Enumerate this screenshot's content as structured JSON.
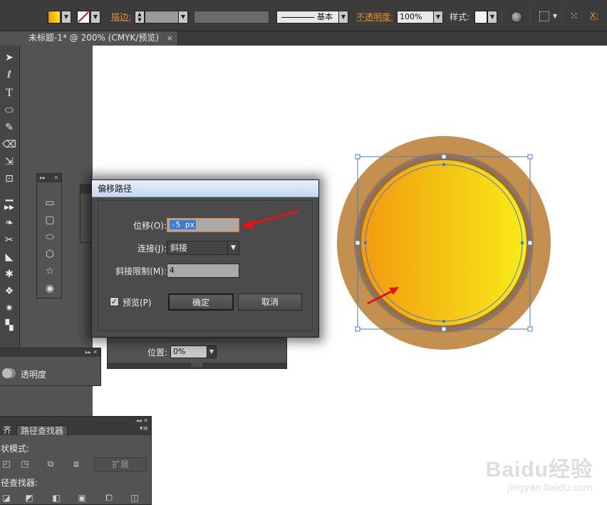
{
  "control_bar": {
    "stroke_label": "描边:",
    "stroke_style_label": "基本",
    "opacity_label": "不透明度:",
    "opacity_value": "100%",
    "style_label": "样式:",
    "x_label": "X:",
    "fill_color": "#f0b000"
  },
  "document_tab": {
    "title": "未标题-1* @ 200% (CMYK/预览)",
    "close": "×"
  },
  "offset_path_dialog": {
    "title": "偏移路径",
    "offset_label": "位移(O):",
    "offset_value": "-5 px",
    "joins_label": "连接(J):",
    "joins_value": "斜接",
    "miter_label": "斜接限制(M):",
    "miter_value": "4",
    "preview_label": "预览(P)",
    "preview_checked": true,
    "ok_label": "确定",
    "cancel_label": "取消"
  },
  "gradient_panel": {
    "location_label": "位置:",
    "location_value": "0%"
  },
  "transparency_panel": {
    "label": "透明度"
  },
  "pathfinder_panel": {
    "tabs": [
      "齐",
      "路径查找器"
    ],
    "shape_modes_label": "状模式:",
    "pathfinders_label": "径查找器:",
    "expand_label": "扩展"
  },
  "artwork": {
    "outer_color": "#c49050",
    "inner_color_left": "#f29a0e",
    "inner_color_right": "#f8ec18",
    "selection_color": "#4a78d8",
    "arrow_color": "#e3121b"
  },
  "watermark": {
    "brand": "Baidu经验",
    "url": "jingyan.baidu.com"
  }
}
